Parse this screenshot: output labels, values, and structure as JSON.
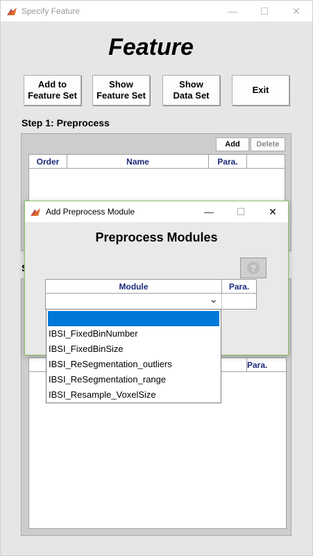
{
  "window": {
    "title": "Specify Feature",
    "minimize_glyph": "—",
    "maximize_glyph": "☐",
    "close_glyph": "✕"
  },
  "main": {
    "heading": "Feature",
    "buttons": {
      "add_to_feature_set": [
        "Add to",
        "Feature Set"
      ],
      "show_feature_set": [
        "Show",
        "Feature Set"
      ],
      "show_data_set": [
        "Show",
        "Data Set"
      ],
      "exit": "Exit"
    },
    "step1": {
      "label": "Step 1: Preprocess",
      "add_label": "Add",
      "delete_label": "Delete",
      "columns": [
        "Order",
        "Name",
        "Para.",
        ""
      ]
    },
    "step2": {
      "partial_label": "S",
      "partial_column": "Para."
    }
  },
  "dialog": {
    "title": "Add Preprocess Module",
    "minimize_glyph": "—",
    "maximize_glyph": "☐",
    "close_glyph": "✕",
    "heading": "Preprocess Modules",
    "help_glyph": "?",
    "columns": [
      "Module",
      "Para."
    ],
    "dropdown_chevron": "⌄",
    "dropdown_options": [
      "",
      "IBSI_FixedBinNumber",
      "IBSI_FixedBinSize",
      "IBSI_ReSegmentation_outliers",
      "IBSI_ReSegmentation_range",
      "IBSI_Resample_VoxelSize"
    ],
    "selected_index": 0
  },
  "colors": {
    "header_text": "#1a2a7a",
    "selection": "#0078d7",
    "dialog_border": "#8cc065"
  }
}
